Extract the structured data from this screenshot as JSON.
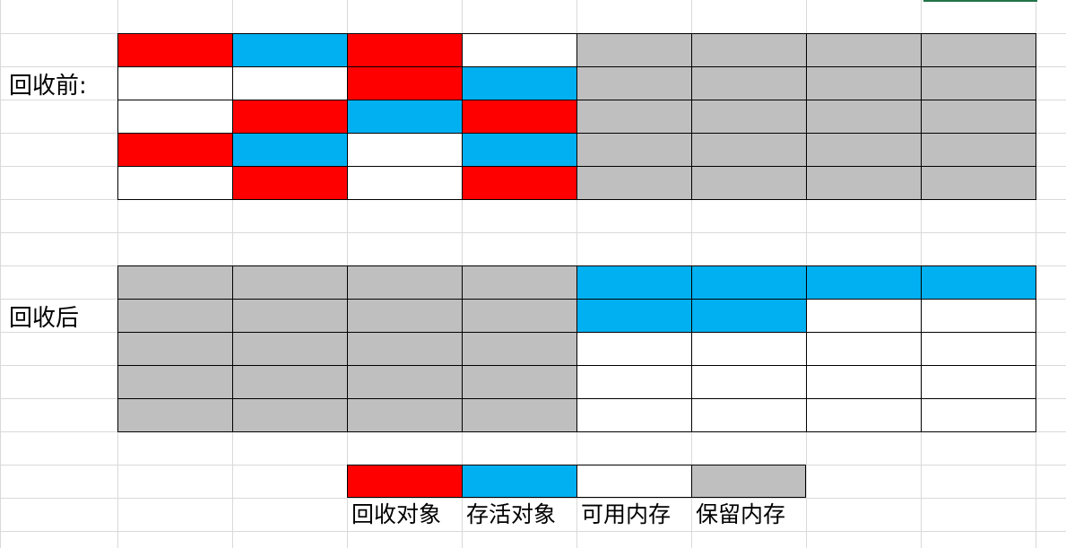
{
  "before_label": "回收前:",
  "after_label": "回收后",
  "colors": {
    "recycled": "#ff0000",
    "alive": "#00b0f0",
    "free": "#ffffff",
    "reserved": "#bfbfbf"
  },
  "before_grid": [
    [
      "recycled",
      "alive",
      "recycled",
      "free",
      "reserved",
      "reserved",
      "reserved",
      "reserved"
    ],
    [
      "free",
      "free",
      "recycled",
      "alive",
      "reserved",
      "reserved",
      "reserved",
      "reserved"
    ],
    [
      "free",
      "recycled",
      "alive",
      "recycled",
      "reserved",
      "reserved",
      "reserved",
      "reserved"
    ],
    [
      "recycled",
      "alive",
      "free",
      "alive",
      "reserved",
      "reserved",
      "reserved",
      "reserved"
    ],
    [
      "free",
      "recycled",
      "free",
      "recycled",
      "reserved",
      "reserved",
      "reserved",
      "reserved"
    ]
  ],
  "after_grid": [
    [
      "reserved",
      "reserved",
      "reserved",
      "reserved",
      "alive",
      "alive",
      "alive",
      "alive"
    ],
    [
      "reserved",
      "reserved",
      "reserved",
      "reserved",
      "alive",
      "alive",
      "free",
      "free"
    ],
    [
      "reserved",
      "reserved",
      "reserved",
      "reserved",
      "free",
      "free",
      "free",
      "free"
    ],
    [
      "reserved",
      "reserved",
      "reserved",
      "reserved",
      "free",
      "free",
      "free",
      "free"
    ],
    [
      "reserved",
      "reserved",
      "reserved",
      "reserved",
      "free",
      "free",
      "free",
      "free"
    ]
  ],
  "legend": [
    {
      "key": "recycled",
      "label": "回收对象"
    },
    {
      "key": "alive",
      "label": "存活对象"
    },
    {
      "key": "free",
      "label": "可用内存"
    },
    {
      "key": "reserved",
      "label": "保留内存"
    }
  ]
}
